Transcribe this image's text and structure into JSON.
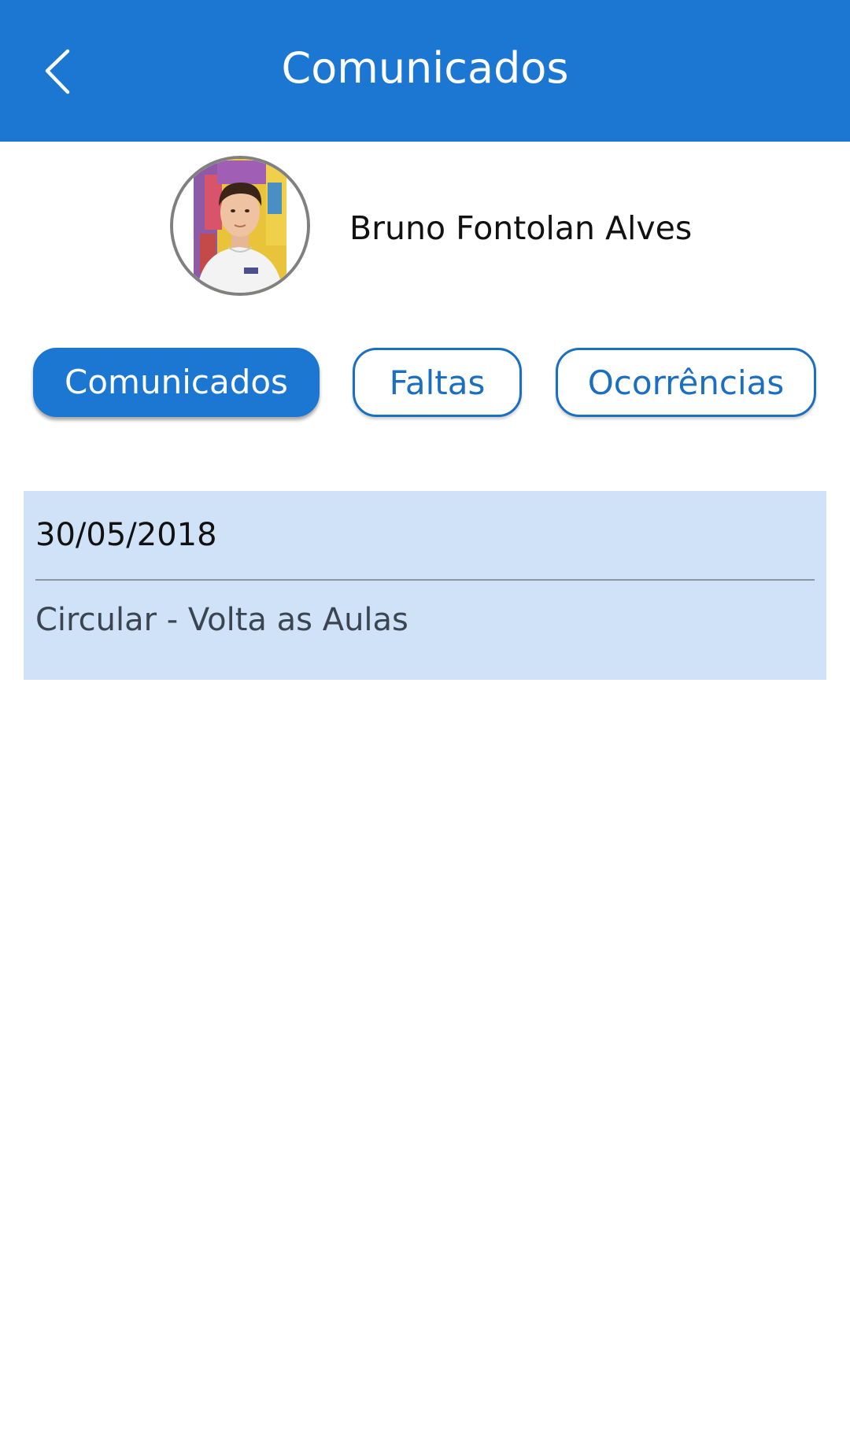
{
  "header": {
    "title": "Comunicados",
    "background_color": "#1b77d2",
    "back_icon": "chevron-left-icon"
  },
  "profile": {
    "student_name": "Bruno Fontolan Alves",
    "avatar": "student-photo"
  },
  "tabs": [
    {
      "label": "Comunicados",
      "active": true
    },
    {
      "label": "Faltas",
      "active": false
    },
    {
      "label": "Ocorrências",
      "active": false
    }
  ],
  "notices": [
    {
      "date": "30/05/2018",
      "title": "Circular - Volta as Aulas"
    }
  ],
  "colors": {
    "accent": "#1b77d2",
    "card_background": "#cfe2f7"
  }
}
